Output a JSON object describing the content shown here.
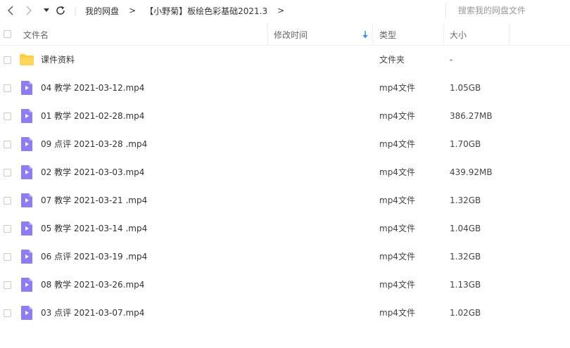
{
  "toolbar": {
    "breadcrumbs": [
      "我的网盘",
      "【小野菊】板绘色彩基础2021.3"
    ],
    "separator": ">",
    "search_placeholder": "搜索我的网盘文件"
  },
  "columns": {
    "name": "文件名",
    "modified": "修改时间",
    "type": "类型",
    "size": "大小"
  },
  "files": [
    {
      "name": "课件资料",
      "type": "文件夹",
      "size": "-",
      "icon": "folder-icon"
    },
    {
      "name": "04 教学 2021-03-12.mp4",
      "type": "mp4文件",
      "size": "1.05GB",
      "icon": "video-file-icon"
    },
    {
      "name": "01 教学 2021-02-28.mp4",
      "type": "mp4文件",
      "size": "386.27MB",
      "icon": "video-file-icon"
    },
    {
      "name": "09 点评 2021-03-28 .mp4",
      "type": "mp4文件",
      "size": "1.70GB",
      "icon": "video-file-icon"
    },
    {
      "name": "02 教学 2021-03-03.mp4",
      "type": "mp4文件",
      "size": "439.92MB",
      "icon": "video-file-icon"
    },
    {
      "name": "07 教学 2021-03-21 .mp4",
      "type": "mp4文件",
      "size": "1.32GB",
      "icon": "video-file-icon"
    },
    {
      "name": "05 教学 2021-03-14 .mp4",
      "type": "mp4文件",
      "size": "1.04GB",
      "icon": "video-file-icon"
    },
    {
      "name": "06 点评 2021-03-19 .mp4",
      "type": "mp4文件",
      "size": "1.32GB",
      "icon": "video-file-icon"
    },
    {
      "name": "08 教学 2021-03-26.mp4",
      "type": "mp4文件",
      "size": "1.13GB",
      "icon": "video-file-icon"
    },
    {
      "name": "03 点评 2021-03-07.mp4",
      "type": "mp4文件",
      "size": "1.02GB",
      "icon": "video-file-icon"
    }
  ],
  "colors": {
    "folder": "#ffcc3e",
    "video": "#8f7cf2",
    "sort_arrow": "#2b8df3"
  }
}
